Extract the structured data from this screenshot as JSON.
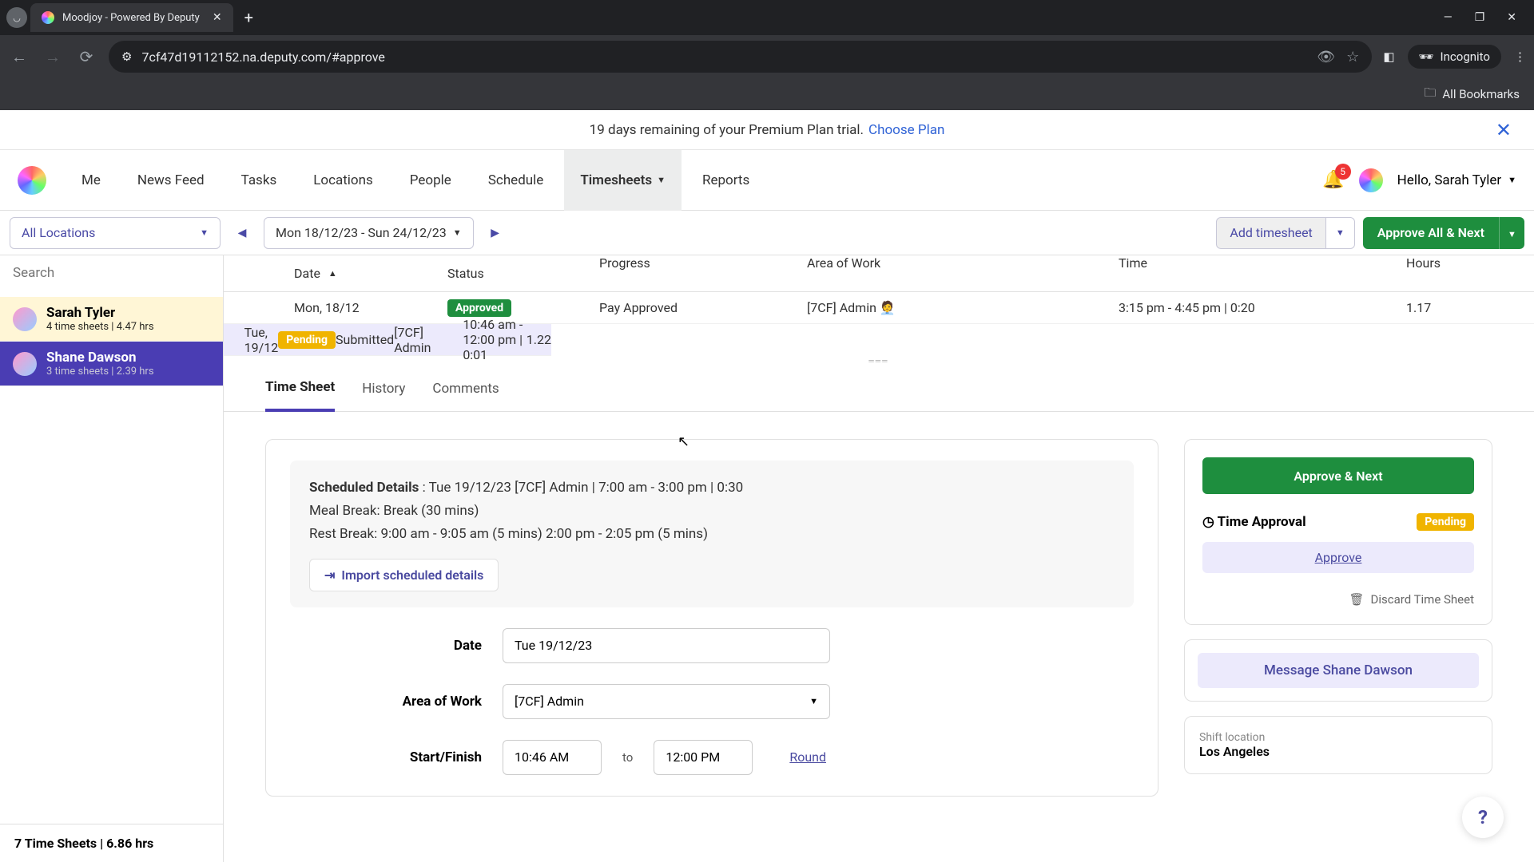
{
  "browser": {
    "tab_title": "Moodjoy - Powered By Deputy",
    "url": "7cf47d19112152.na.deputy.com/#approve",
    "incognito_label": "Incognito",
    "bookmarks_label": "All Bookmarks"
  },
  "banner": {
    "text": "19 days remaining of your Premium Plan trial. ",
    "link": "Choose Plan"
  },
  "nav": {
    "items": [
      "Me",
      "News Feed",
      "Tasks",
      "Locations",
      "People",
      "Schedule",
      "Timesheets",
      "Reports"
    ],
    "active_index": 6,
    "notif_count": "5",
    "greeting": "Hello, Sarah Tyler"
  },
  "toolbar": {
    "locations": "All Locations",
    "date_range": "Mon 18/12/23 - Sun 24/12/23",
    "add_timesheet": "Add timesheet",
    "approve_all": "Approve All & Next"
  },
  "columns": [
    "Date",
    "Status",
    "Progress",
    "Area of Work",
    "Time",
    "Hours"
  ],
  "employees": [
    {
      "name": "Sarah Tyler",
      "meta": "4 time sheets | 4.47 hrs"
    },
    {
      "name": "Shane Dawson",
      "meta": "3 time sheets | 2.39 hrs"
    }
  ],
  "sidebar_footer": "7 Time Sheets | 6.86 hrs",
  "search_placeholder": "Search",
  "rows": [
    {
      "date": "Mon, 18/12",
      "status": "Approved",
      "status_class": "approved",
      "progress": "Pay Approved",
      "area": "[7CF] Admin 🧑‍💼",
      "time": "3:15 pm - 4:45 pm | 0:20",
      "hours": "1.17"
    },
    {
      "date": "Tue, 19/12",
      "status": "Pending",
      "status_class": "pending",
      "progress": "Submitted",
      "area": "[7CF] Admin",
      "time": "10:46 am - 12:00 pm | 0:01",
      "hours": "1.22"
    }
  ],
  "tabs": [
    "Time Sheet",
    "History",
    "Comments"
  ],
  "scheduled": {
    "label": "Scheduled Details",
    "line1": " : Tue 19/12/23 [7CF] Admin | 7:00 am - 3:00 pm | 0:30",
    "line2": "Meal Break: Break (30 mins)",
    "line3": "Rest Break: 9:00 am - 9:05 am (5 mins) 2:00 pm - 2:05 pm (5 mins)",
    "import": "Import scheduled details"
  },
  "form": {
    "date_label": "Date",
    "date_value": "Tue 19/12/23",
    "area_label": "Area of Work",
    "area_value": "[7CF] Admin",
    "sf_label": "Start/Finish",
    "start": "10:46 AM",
    "to": "to",
    "finish": "12:00 PM",
    "round": "Round"
  },
  "approval": {
    "approve_next": "Approve & Next",
    "title": "Time Approval",
    "status": "Pending",
    "approve": "Approve",
    "discard": "Discard Time Sheet",
    "message": "Message Shane Dawson",
    "shift_loc_label": "Shift location",
    "shift_loc_value": "Los Angeles"
  }
}
